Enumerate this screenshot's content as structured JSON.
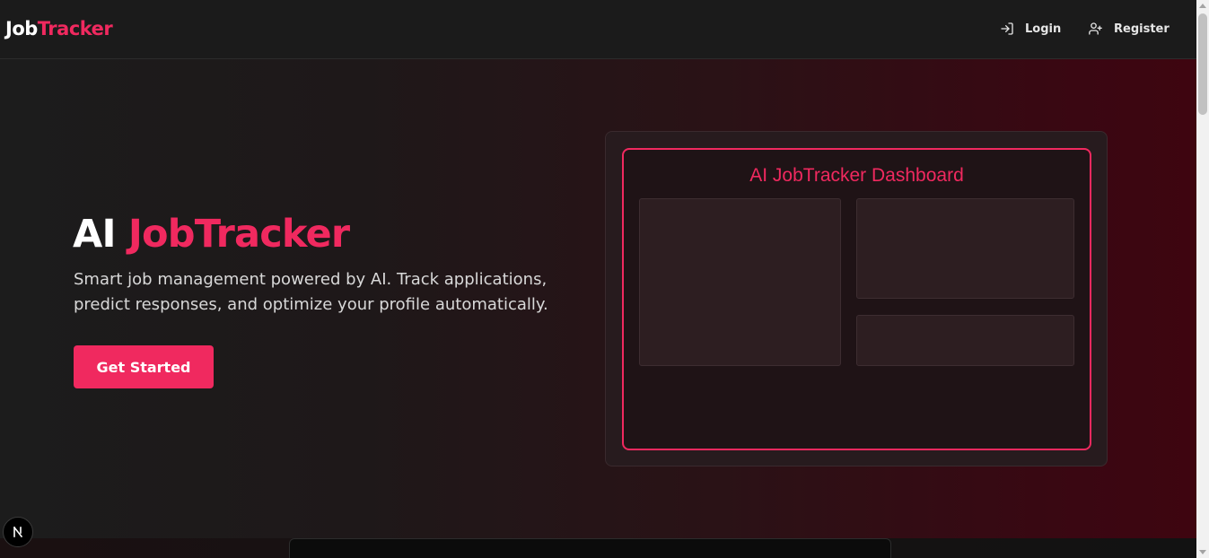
{
  "brand": {
    "part1": "Job",
    "part2": "Tracker"
  },
  "nav": {
    "login_label": "Login",
    "register_label": "Register"
  },
  "hero": {
    "title_part1": "AI ",
    "title_part2": "JobTracker",
    "subtitle": "Smart job management powered by AI. Track applications, predict responses, and optimize your profile automatically.",
    "cta_label": "Get Started"
  },
  "preview": {
    "title": "AI JobTracker Dashboard"
  },
  "colors": {
    "accent": "#f0295f",
    "background": "#1b1b1b"
  },
  "icons": {
    "login": "login-icon",
    "register": "user-plus-icon",
    "dev_badge": "next-logo-icon"
  }
}
